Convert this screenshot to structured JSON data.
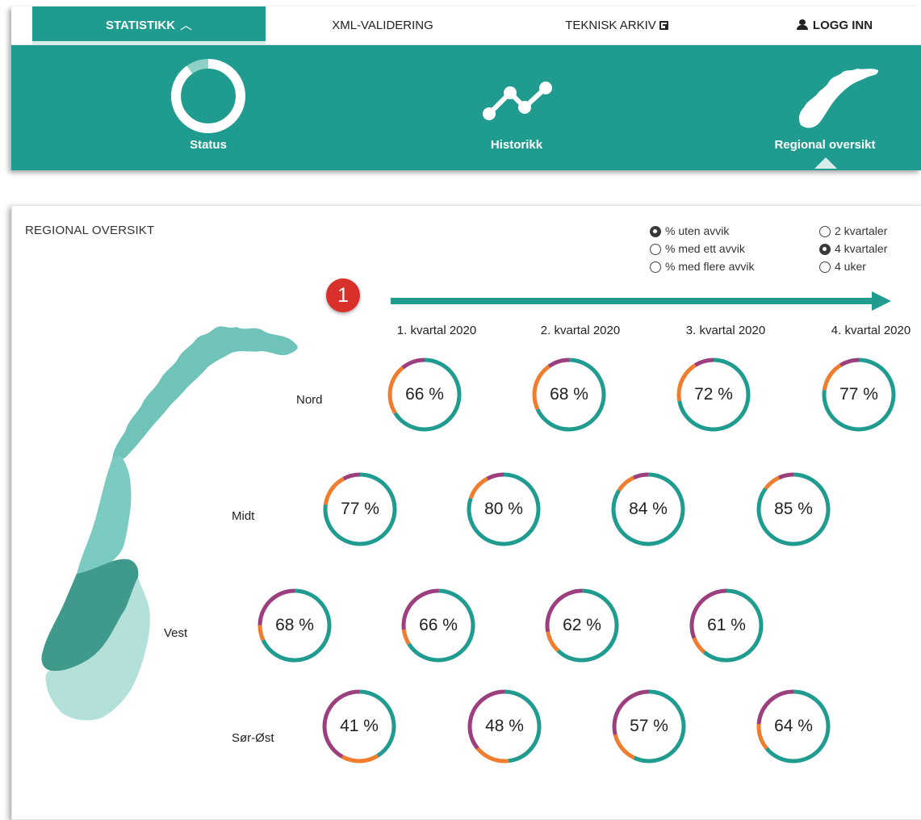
{
  "colors": {
    "teal": "#1f9b8f",
    "orange": "#f07c2e",
    "purple": "#9c3f7e",
    "badge_red": "#d9302c"
  },
  "nav": {
    "statistikk": "STATISTIKK",
    "xml": "XML-VALIDERING",
    "arkiv": "TEKNISK ARKIV",
    "login": "LOGG INN"
  },
  "subnav": {
    "status": "Status",
    "historikk": "Historikk",
    "regional": "Regional oversikt",
    "status_ring_fraction": 0.9
  },
  "card": {
    "title": "REGIONAL OVERSIKT",
    "step_badge": "1"
  },
  "filters": {
    "metric": [
      {
        "label": "% uten avvik",
        "selected": true
      },
      {
        "label": "% med ett avvik",
        "selected": false
      },
      {
        "label": "% med flere avvik",
        "selected": false
      }
    ],
    "period": [
      {
        "label": "2 kvartaler",
        "selected": false
      },
      {
        "label": "4 kvartaler",
        "selected": true
      },
      {
        "label": "4 uker",
        "selected": false
      }
    ]
  },
  "quarters": [
    "1. kvartal 2020",
    "2. kvartal 2020",
    "3. kvartal 2020",
    "4. kvartal 2020"
  ],
  "regions": [
    {
      "name": "Nord",
      "cells": [
        {
          "label": "66 %",
          "none": 0.66,
          "one": 0.23
        },
        {
          "label": "68 %",
          "none": 0.68,
          "one": 0.22
        },
        {
          "label": "72 %",
          "none": 0.72,
          "one": 0.19
        },
        {
          "label": "77 %",
          "none": 0.77,
          "one": 0.14
        }
      ]
    },
    {
      "name": "Midt",
      "cells": [
        {
          "label": "77 %",
          "none": 0.77,
          "one": 0.15
        },
        {
          "label": "80 %",
          "none": 0.8,
          "one": 0.12
        },
        {
          "label": "84 %",
          "none": 0.84,
          "one": 0.09
        },
        {
          "label": "85 %",
          "none": 0.85,
          "one": 0.08
        }
      ]
    },
    {
      "name": "Vest",
      "cells": [
        {
          "label": "68 %",
          "none": 0.68,
          "one": 0.07
        },
        {
          "label": "66 %",
          "none": 0.66,
          "one": 0.07
        },
        {
          "label": "62 %",
          "none": 0.62,
          "one": 0.1
        },
        {
          "label": "61 %",
          "none": 0.61,
          "one": 0.08
        }
      ]
    },
    {
      "name": "Sør-Øst",
      "cells": [
        {
          "label": "41 %",
          "none": 0.41,
          "one": 0.17
        },
        {
          "label": "48 %",
          "none": 0.48,
          "one": 0.16
        },
        {
          "label": "57 %",
          "none": 0.57,
          "one": 0.14
        },
        {
          "label": "64 %",
          "none": 0.64,
          "one": 0.12
        }
      ]
    }
  ]
}
